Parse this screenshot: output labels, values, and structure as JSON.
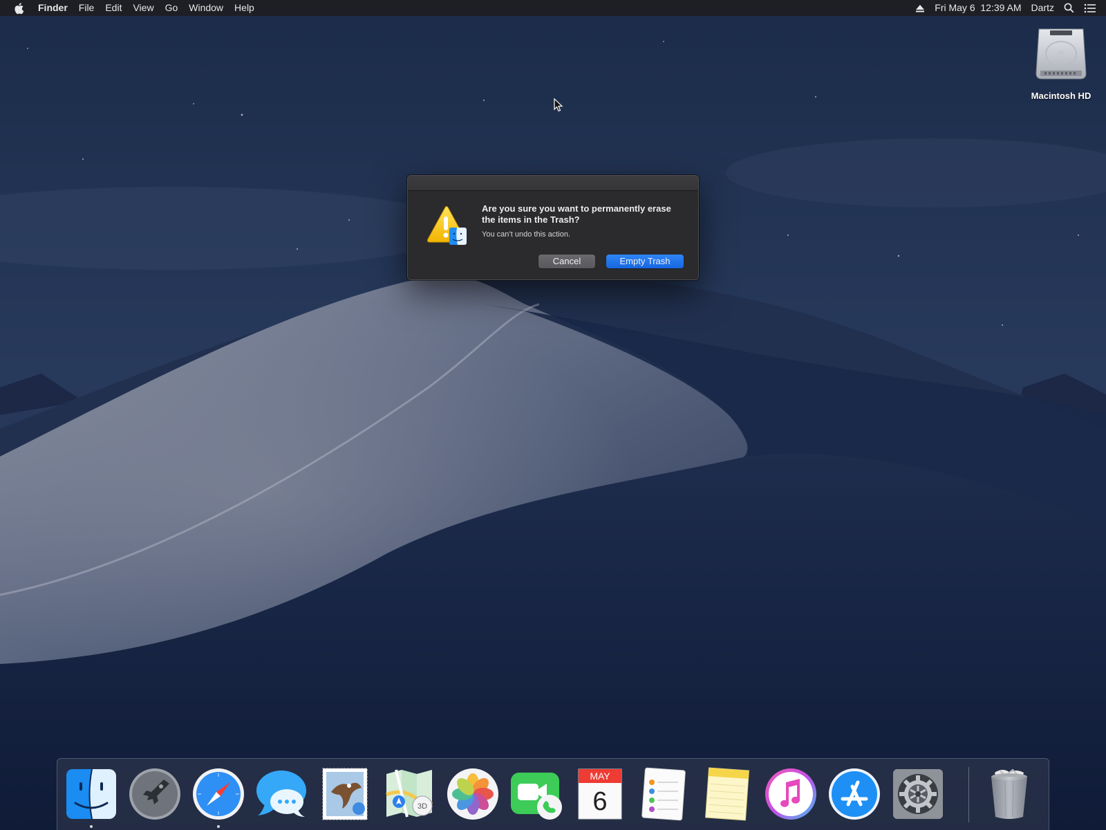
{
  "menubar": {
    "app_name": "Finder",
    "menus": [
      "File",
      "Edit",
      "View",
      "Go",
      "Window",
      "Help"
    ],
    "datetime": "Fri May 6  12:39 AM",
    "user": "Dartz"
  },
  "desktop": {
    "icons": [
      {
        "label": "Macintosh HD",
        "icon": "hard-drive-icon"
      }
    ]
  },
  "dialog": {
    "message": "Are you sure you want to permanently erase the items in the Trash?",
    "informative": "You can’t undo this action.",
    "cancel_label": "Cancel",
    "confirm_label": "Empty Trash",
    "icon": "caution-finder-icon"
  },
  "dock": {
    "apps": [
      {
        "name": "Finder",
        "icon": "finder-icon",
        "running": true
      },
      {
        "name": "Launchpad",
        "icon": "launchpad-icon",
        "running": false
      },
      {
        "name": "Safari",
        "icon": "safari-icon",
        "running": true
      },
      {
        "name": "Messages",
        "icon": "messages-icon",
        "running": false
      },
      {
        "name": "Mail",
        "icon": "mail-icon",
        "running": false
      },
      {
        "name": "Maps",
        "icon": "maps-icon",
        "running": false
      },
      {
        "name": "Photos",
        "icon": "photos-icon",
        "running": false
      },
      {
        "name": "FaceTime",
        "icon": "facetime-icon",
        "running": false
      },
      {
        "name": "Calendar",
        "icon": "calendar-icon",
        "running": false
      },
      {
        "name": "Reminders",
        "icon": "reminders-icon",
        "running": false
      },
      {
        "name": "Notes",
        "icon": "notes-icon",
        "running": false
      },
      {
        "name": "iTunes",
        "icon": "itunes-icon",
        "running": false
      },
      {
        "name": "App Store",
        "icon": "app-store-icon",
        "running": false
      },
      {
        "name": "System Preferences",
        "icon": "system-preferences-icon",
        "running": false
      },
      {
        "name": "Trash",
        "icon": "trash-full-icon",
        "running": false
      }
    ],
    "calendar_month": "MAY",
    "calendar_day": "6",
    "maps_badge": "3D"
  },
  "colors": {
    "accent": "#1a6fe8",
    "menubar": "#1e1e22",
    "dialog": "#2b2b2d"
  }
}
